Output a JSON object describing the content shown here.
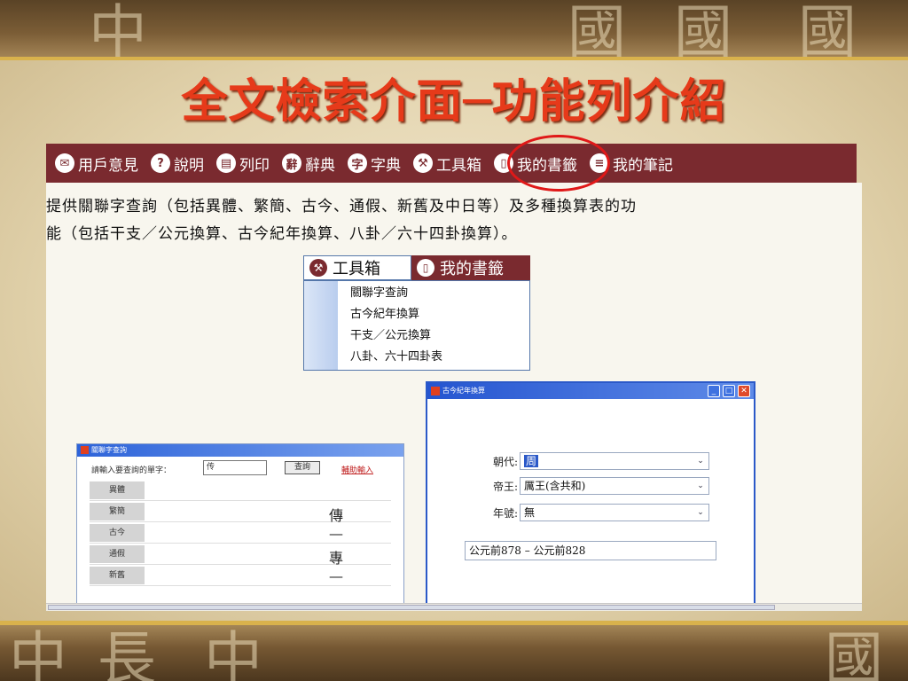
{
  "slide": {
    "title": "全文檢索介面─功能列介紹",
    "band_top_glyphs": [
      "中",
      "國",
      "國",
      "國"
    ],
    "band_bottom_glyphs": [
      "中",
      "長",
      "中",
      "國"
    ]
  },
  "toolbar": {
    "items": [
      {
        "icon": "feedback-icon",
        "glyph": "✉",
        "label": "用戶意見"
      },
      {
        "icon": "help-icon",
        "glyph": "?",
        "label": "說明"
      },
      {
        "icon": "print-icon",
        "glyph": "▤",
        "label": "列印"
      },
      {
        "icon": "dictionary-icon",
        "glyph": "辭",
        "label": "辭典"
      },
      {
        "icon": "character-dictionary-icon",
        "glyph": "字",
        "label": "字典"
      },
      {
        "icon": "toolbox-icon",
        "glyph": "⚒",
        "label": "工具箱"
      },
      {
        "icon": "bookmark-icon",
        "glyph": "▯",
        "label": "我的書籤"
      },
      {
        "icon": "notes-icon",
        "glyph": "≡",
        "label": "我的筆記"
      }
    ],
    "highlight_color": "#e01818",
    "background_color": "#7a2a2f"
  },
  "description": {
    "line1": "提供關聯字查詢（包括異體、繁簡、古今、通假、新舊及中日等）及多種換算表的功",
    "line2": "能（包括干支／公元換算、古今紀年換算、八卦／六十四卦換算）。"
  },
  "toolbox_menu": {
    "tab_active": "工具箱",
    "tab_other": "我的書籤",
    "items": [
      "關聯字查詢",
      "古今紀年換算",
      "干支／公元換算",
      "八卦、六十四卦表"
    ]
  },
  "lookup_window": {
    "title": "關聯字查詢",
    "prompt": "請輸入要查詢的單字：",
    "input_value": "传",
    "query_button": "查詢",
    "assist_link": "輔助輸入",
    "rows": [
      {
        "label": "異體",
        "value": ""
      },
      {
        "label": "繁簡",
        "value": "傳"
      },
      {
        "label": "古今",
        "value": "—"
      },
      {
        "label": "通假",
        "value": "專"
      },
      {
        "label": "新舊",
        "value": "—"
      }
    ]
  },
  "conversion_window": {
    "title": "古今紀年換算",
    "fields": [
      {
        "label": "朝代:",
        "value": "周"
      },
      {
        "label": "帝王:",
        "value": "厲王(含共和)"
      },
      {
        "label": "年號:",
        "value": "無"
      }
    ],
    "result": "公元前878 – 公元前828",
    "controls": {
      "minimize": "_",
      "maximize": "□",
      "close": "✕"
    }
  }
}
